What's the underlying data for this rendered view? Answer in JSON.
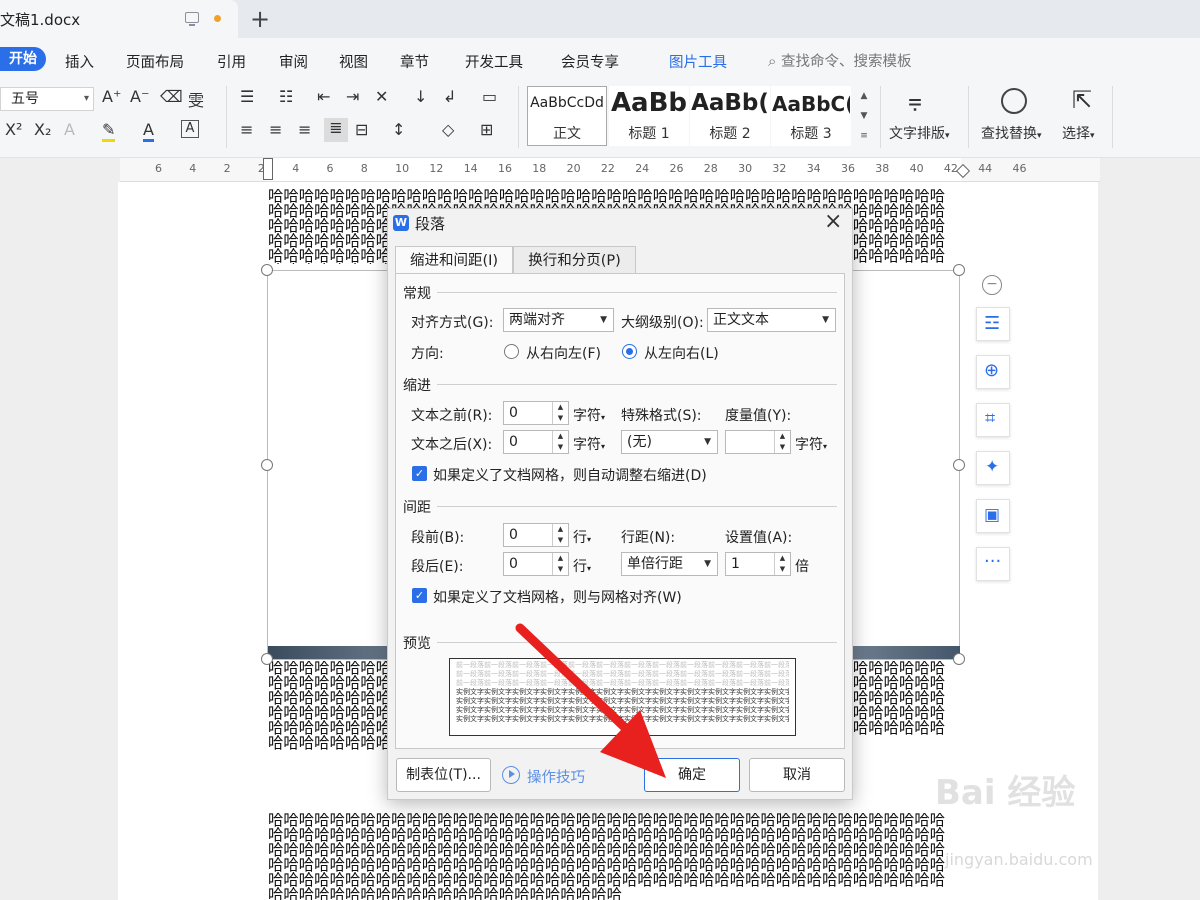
{
  "tab": {
    "title": "文稿1.docx"
  },
  "menu": [
    "开始",
    "插入",
    "页面布局",
    "引用",
    "审阅",
    "视图",
    "章节",
    "开发工具",
    "会员专享",
    "图片工具"
  ],
  "search_cmd": "查找命令、搜索模板",
  "ribbon": {
    "font_size": "五号",
    "styles": [
      {
        "sample": "AaBbCcDd",
        "label": "正文"
      },
      {
        "sample": "AaBb",
        "label": "标题 1"
      },
      {
        "sample": "AaBb(",
        "label": "标题 2"
      },
      {
        "sample": "AaBbC(",
        "label": "标题 3"
      }
    ],
    "text_layout": "文字排版",
    "find_replace": "查找替换",
    "select": "选择"
  },
  "ruler": [
    "6",
    "4",
    "2",
    "2",
    "4",
    "6",
    "8",
    "10",
    "12",
    "14",
    "16",
    "18",
    "20",
    "22",
    "24",
    "26",
    "28",
    "30",
    "32",
    "34",
    "36",
    "38",
    "40",
    "42",
    "44",
    "46"
  ],
  "doc_text": "哈哈哈哈哈哈哈哈哈哈哈哈哈哈哈哈哈哈哈哈哈哈哈哈哈哈哈哈哈哈哈哈哈哈哈哈哈哈哈哈哈哈哈哈哈哈哈哈哈哈哈哈哈哈哈哈哈哈哈哈哈哈哈哈哈哈哈哈哈哈哈哈哈哈哈哈哈哈哈哈哈哈哈哈哈哈哈哈哈哈哈哈哈哈哈哈哈哈哈哈哈哈哈哈哈哈哈哈哈哈哈哈哈哈哈哈哈哈哈哈哈哈哈哈哈哈哈哈哈哈哈哈哈哈哈哈哈哈哈哈哈哈哈哈哈哈哈哈哈哈哈哈哈哈哈哈哈哈哈哈哈哈哈哈哈哈哈哈哈哈哈哈哈哈哈哈哈哈哈哈哈哈哈哈哈哈哈哈哈哈哈哈哈哈哈哈哈哈哈哈哈哈哈哈哈哈哈哈哈哈哈哈哈哈哈哈哈哈哈哈哈哈哈哈哈哈哈哈哈哈哈哈哈哈哈哈哈哈哈哈哈哈哈",
  "dialog": {
    "title": "段落",
    "tabs": [
      "缩进和间距(I)",
      "换行和分页(P)"
    ],
    "general": {
      "section": "常规",
      "align_label": "对齐方式(G):",
      "align_value": "两端对齐",
      "outline_label": "大纲级别(O):",
      "outline_value": "正文文本",
      "direction_label": "方向:",
      "rtl": "从右向左(F)",
      "ltr": "从左向右(L)"
    },
    "indent": {
      "section": "缩进",
      "before_label": "文本之前(R):",
      "before_value": "0",
      "before_unit": "字符",
      "after_label": "文本之后(X):",
      "after_value": "0",
      "after_unit": "字符",
      "special_label": "特殊格式(S):",
      "special_value": "(无)",
      "measure_label": "度量值(Y):",
      "measure_value": "",
      "measure_unit": "字符",
      "auto_adjust": "如果定义了文档网格，则自动调整右缩进(D)"
    },
    "spacing": {
      "section": "间距",
      "before_label": "段前(B):",
      "before_value": "0",
      "before_unit": "行",
      "after_label": "段后(E):",
      "after_value": "0",
      "after_unit": "行",
      "line_label": "行距(N):",
      "line_value": "单倍行距",
      "setting_label": "设置值(A):",
      "setting_value": "1",
      "setting_unit": "倍",
      "snap_grid": "如果定义了文档网格，则与网格对齐(W)"
    },
    "preview": {
      "section": "预览",
      "prev_line": "前一段落前一段落前一段落前一段落前一段落前一段落前一段落前一段落前一段落前一段落前一段落前一段落",
      "sample_line": "实例文字实例文字实例文字实例文字实例文字实例文字实例文字实例文字实例文字实例文字实例文字实例文字实例文字"
    },
    "tabstops_button": "制表位(T)...",
    "tips_link": "操作技巧",
    "ok_button": "确定",
    "cancel_button": "取消"
  },
  "colors": {
    "accent": "#2a6ee8",
    "arrow": "#e8201e"
  },
  "watermark": {
    "brand": "Bai 经验",
    "url": "jingyan.baidu.com"
  }
}
